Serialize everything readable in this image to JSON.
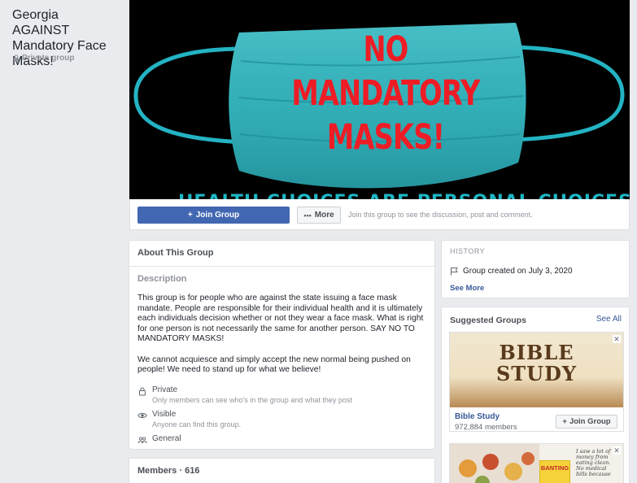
{
  "sidebar": {
    "group_name": "Georgia AGAINST Mandatory Face Masks!",
    "privacy": "Private group"
  },
  "cover": {
    "headline_lines": [
      "NO",
      "MANDATORY",
      "MASKS!"
    ],
    "strip_text": "HEALTH CHOICES ARE PERSONAL CHOICES",
    "colors": {
      "headline": "#ee1c25",
      "mask": "#27b9c4",
      "background": "#000000"
    }
  },
  "action_bar": {
    "join_label": "Join Group",
    "more_label": "More",
    "hint": "Join this group to see the discussion, post and comment."
  },
  "about": {
    "title": "About This Group",
    "description_label": "Description",
    "description": "This group is for people who are against the state issuing a face mask mandate. People are responsible for their individual health and it is ultimately each individuals decision whether or not they wear a face mask. What is right for one person is not necessarily the same for another person. SAY NO TO MANDATORY MASKS!\n\nWe cannot acquiesce and simply accept the new normal being pushed on people! We need to stand up for what we believe!",
    "private_title": "Private",
    "private_sub": "Only members can see who's in the group and what they post",
    "visible_title": "Visible",
    "visible_sub": "Anyone can find this group.",
    "general_title": "General"
  },
  "members": {
    "title": "Members · 616"
  },
  "history": {
    "label": "HISTORY",
    "created": "Group created on July 3, 2020",
    "see_more": "See More"
  },
  "suggested": {
    "title": "Suggested Groups",
    "see_all": "See All",
    "groups": [
      {
        "image_text_line1": "BIBLE",
        "image_text_line2": "STUDY",
        "name": "Bible Study",
        "members": "972,884 members",
        "join_label": "Join Group"
      },
      {
        "book_title": "BANTING",
        "note_text": "I saw a lot of money from eating clean. No medical bills because"
      }
    ]
  },
  "accent_color": "#4267b2",
  "link_color": "#385898"
}
